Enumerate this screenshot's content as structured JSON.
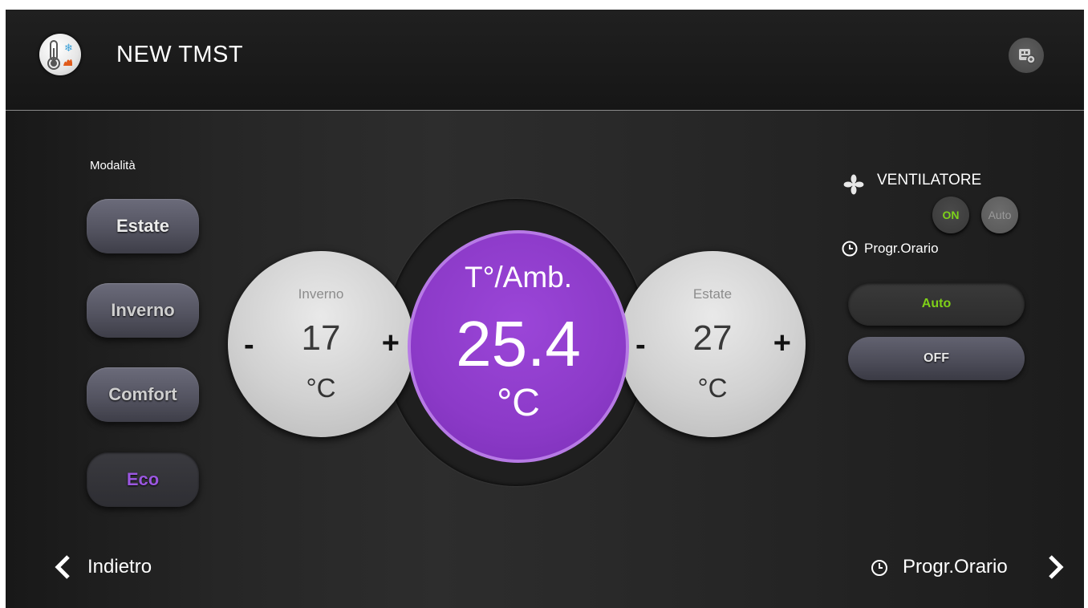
{
  "header": {
    "title": "NEW TMST",
    "app_icon": "thermostat-icon",
    "action_icon": "device-settings-icon"
  },
  "modes": {
    "label": "Modalità",
    "items": [
      {
        "label": "Estate"
      },
      {
        "label": "Inverno"
      },
      {
        "label": "Comfort"
      },
      {
        "label": "Eco",
        "active": true
      }
    ]
  },
  "setpoints": {
    "winter": {
      "label": "Inverno",
      "value": "17",
      "unit": "°C",
      "minus": "-",
      "plus": "+"
    },
    "summer": {
      "label": "Estate",
      "value": "27",
      "unit": "°C",
      "minus": "-",
      "plus": "+"
    }
  },
  "ambient": {
    "label": "T°/Amb.",
    "value": "25.4",
    "unit": "°C"
  },
  "fan": {
    "label": "VENTILATORE",
    "on_label": "ON",
    "auto_label": "Auto"
  },
  "schedule": {
    "label": "Progr.Orario",
    "auto_label": "Auto",
    "off_label": "OFF"
  },
  "footer": {
    "back_label": "Indietro",
    "forward_label": "Progr.Orario"
  },
  "colors": {
    "accent_purple": "#8c3ac8",
    "active_green": "#7dd11a",
    "eco_text": "#9b57e0"
  }
}
